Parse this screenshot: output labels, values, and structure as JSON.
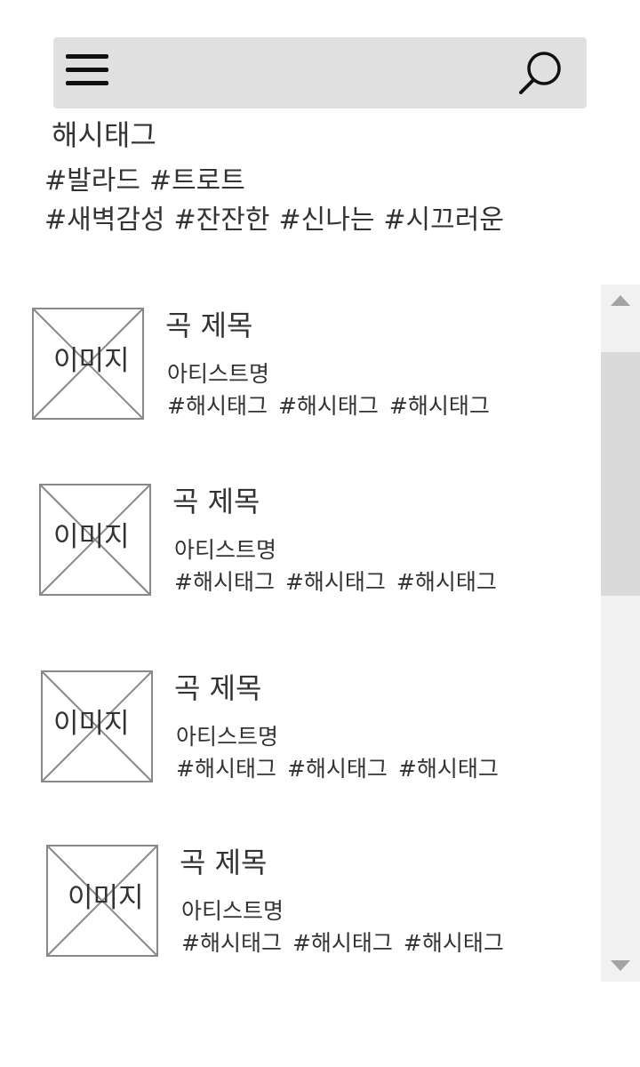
{
  "header": {
    "menu_icon": "hamburger-menu-icon",
    "search_icon": "search-icon"
  },
  "hashtag_section": {
    "title": "해시태그",
    "rows": [
      [
        "#발라드",
        "#트로트"
      ],
      [
        "#새벽감성",
        "#잔잔한",
        "#신나는",
        "#시끄러운"
      ]
    ]
  },
  "songs": [
    {
      "image_label": "이미지",
      "title": "곡 제목",
      "artist": "아티스트명",
      "tags": [
        "#해시태그",
        "#해시태그",
        "#해시태그"
      ]
    },
    {
      "image_label": "이미지",
      "title": "곡 제목",
      "artist": "아티스트명",
      "tags": [
        "#해시태그",
        "#해시태그",
        "#해시태그"
      ]
    },
    {
      "image_label": "이미지",
      "title": "곡 제목",
      "artist": "아티스트명",
      "tags": [
        "#해시태그",
        "#해시태그",
        "#해시태그"
      ]
    },
    {
      "image_label": "이미지",
      "title": "곡 제목",
      "artist": "아티스트명",
      "tags": [
        "#해시태그",
        "#해시태그",
        "#해시태그"
      ]
    }
  ],
  "scrollbar": {
    "up_icon": "arrow-up-icon",
    "down_icon": "arrow-down-icon"
  },
  "colors": {
    "topbar_bg": "#e0e0e0",
    "text": "#333333",
    "placeholder_line": "#888888",
    "scrollbar_track": "#f1f1f1",
    "scrollbar_thumb": "#dadada"
  }
}
